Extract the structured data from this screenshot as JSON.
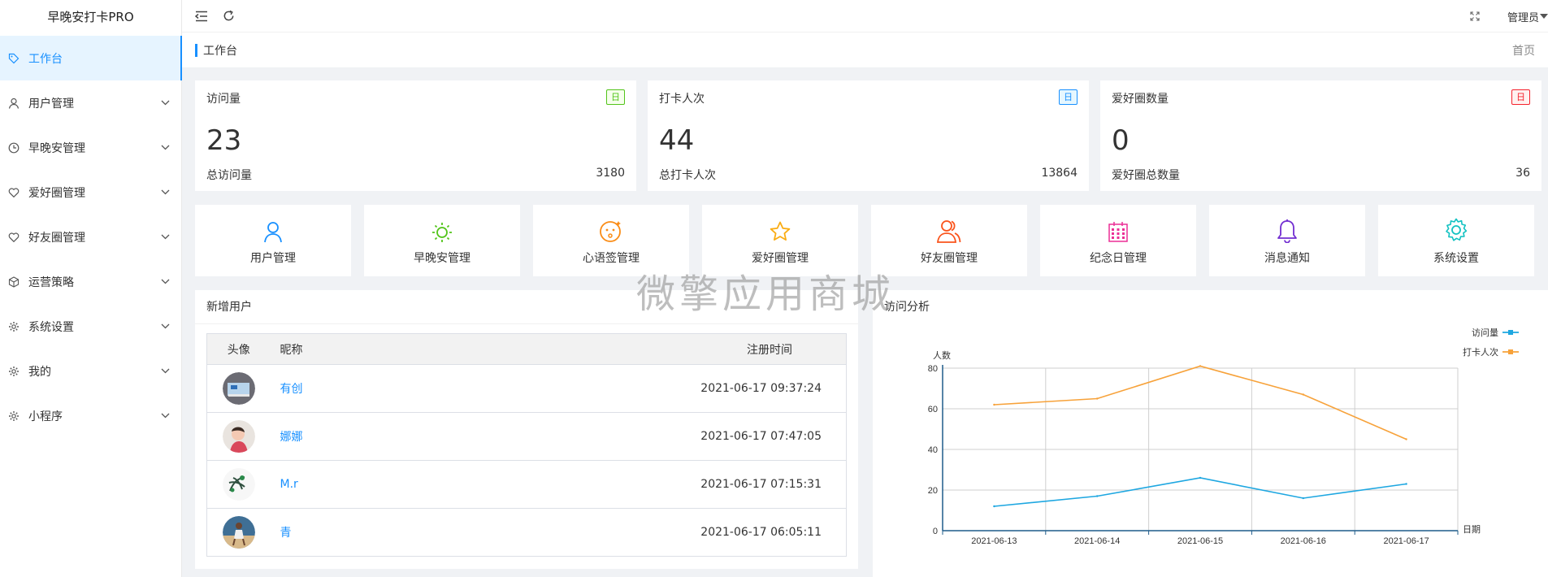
{
  "app": {
    "title": "早晚安打卡PRO"
  },
  "sidebar": {
    "items": [
      {
        "label": "工作台",
        "icon": "tag-icon",
        "active": true
      },
      {
        "label": "用户管理",
        "icon": "user-icon"
      },
      {
        "label": "早晚安管理",
        "icon": "clock-icon"
      },
      {
        "label": "爱好圈管理",
        "icon": "heart-icon"
      },
      {
        "label": "好友圈管理",
        "icon": "heart-icon"
      },
      {
        "label": "运营策略",
        "icon": "cube-icon"
      },
      {
        "label": "系统设置",
        "icon": "gear-icon"
      },
      {
        "label": "我的",
        "icon": "gear-icon"
      },
      {
        "label": "小程序",
        "icon": "gear-icon"
      }
    ]
  },
  "topbar": {
    "admin_label": "管理员"
  },
  "crumb": {
    "title": "工作台",
    "home": "首页"
  },
  "stats": [
    {
      "title": "访问量",
      "badge": "日",
      "color": "#52c41a",
      "badge_bg": "#f6ffed",
      "value": "23",
      "sub": "总访问量",
      "total": "3180"
    },
    {
      "title": "打卡人次",
      "badge": "日",
      "color": "#1890ff",
      "badge_bg": "#e6f7ff",
      "value": "44",
      "sub": "总打卡人次",
      "total": "13864"
    },
    {
      "title": "爱好圈数量",
      "badge": "日",
      "color": "#f5222d",
      "badge_bg": "#fff1f0",
      "value": "0",
      "sub": "爱好圈总数量",
      "total": "36"
    }
  ],
  "quick": [
    {
      "label": "用户管理",
      "icon": "user-icon",
      "color": "#1890ff"
    },
    {
      "label": "早晚安管理",
      "icon": "sun-icon",
      "color": "#52c41a"
    },
    {
      "label": "心语签管理",
      "icon": "face-icon",
      "color": "#fa8c16"
    },
    {
      "label": "爱好圈管理",
      "icon": "star-icon",
      "color": "#faad14"
    },
    {
      "label": "好友圈管理",
      "icon": "users-icon",
      "color": "#fa541c"
    },
    {
      "label": "纪念日管理",
      "icon": "calendar-icon",
      "color": "#eb2f96"
    },
    {
      "label": "消息通知",
      "icon": "bell-icon",
      "color": "#722ed1"
    },
    {
      "label": "系统设置",
      "icon": "gear-icon",
      "color": "#13c2c2"
    }
  ],
  "users_panel": {
    "title": "新增用户",
    "columns": {
      "avatar": "头像",
      "nick": "昵称",
      "time": "注册时间"
    },
    "rows": [
      {
        "nick": "有创",
        "time": "2021-06-17 09:37:24"
      },
      {
        "nick": "娜娜",
        "time": "2021-06-17 07:47:05"
      },
      {
        "nick": "M.r",
        "time": "2021-06-17 07:15:31"
      },
      {
        "nick": "青",
        "time": "2021-06-17 06:05:11"
      }
    ]
  },
  "visits_panel": {
    "title": "访问分析"
  },
  "chart_data": {
    "type": "line",
    "x": [
      "2021-06-13",
      "2021-06-14",
      "2021-06-15",
      "2021-06-16",
      "2021-06-17"
    ],
    "series": [
      {
        "name": "访问量",
        "values": [
          12,
          17,
          26,
          16,
          23
        ],
        "color": "#1ea7e1"
      },
      {
        "name": "打卡人次",
        "values": [
          62,
          65,
          81,
          67,
          45
        ],
        "color": "#f7a23a"
      }
    ],
    "ylabel": "人数",
    "xlabel": "日期",
    "ylim": [
      0,
      80
    ],
    "yticks": [
      0,
      20,
      40,
      60,
      80
    ],
    "grid": true,
    "legend": "top-right"
  },
  "watermark": "微擎应用商城"
}
